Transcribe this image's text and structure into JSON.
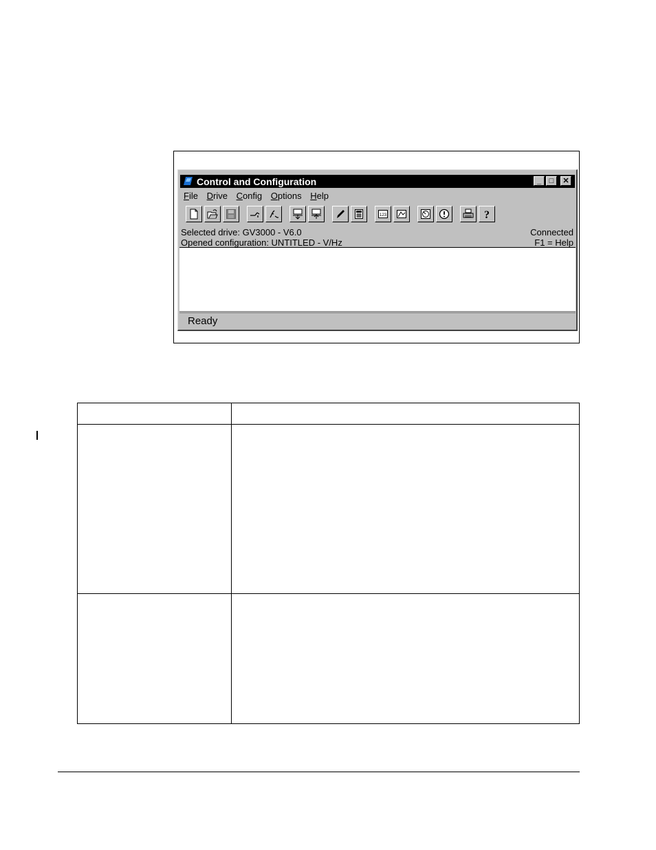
{
  "window": {
    "title": "Control and Configuration",
    "controls": {
      "minimize": "_",
      "maximize": "□",
      "close": "✕"
    },
    "title_bg": "#000000",
    "face_color": "#c0c0c0",
    "icon_color": "#1a6fd1"
  },
  "menu": [
    {
      "accel": "F",
      "rest": "ile"
    },
    {
      "accel": "D",
      "rest": "rive"
    },
    {
      "accel": "C",
      "rest": "onfig"
    },
    {
      "accel": "O",
      "rest": "ptions"
    },
    {
      "accel": "H",
      "rest": "elp"
    }
  ],
  "toolbar": {
    "icons": [
      "new-file-icon",
      "open-folder-icon",
      "save-disk-icon",
      "connect-icon",
      "disconnect-icon",
      "upload-icon",
      "download-icon",
      "edit-pencil-icon",
      "calculator-icon",
      "numeric-display-icon",
      "graph-icon",
      "monitor-gauge-icon",
      "alert-icon",
      "print-icon",
      "help-icon"
    ]
  },
  "info": {
    "selected_drive": "Selected drive: GV3000 - V6.0",
    "connection": "Connected",
    "opened_configuration": "Opened configuration: UNTITLED - V/Hz",
    "help_hint": "F1 = Help"
  },
  "status": {
    "text": "Ready"
  }
}
